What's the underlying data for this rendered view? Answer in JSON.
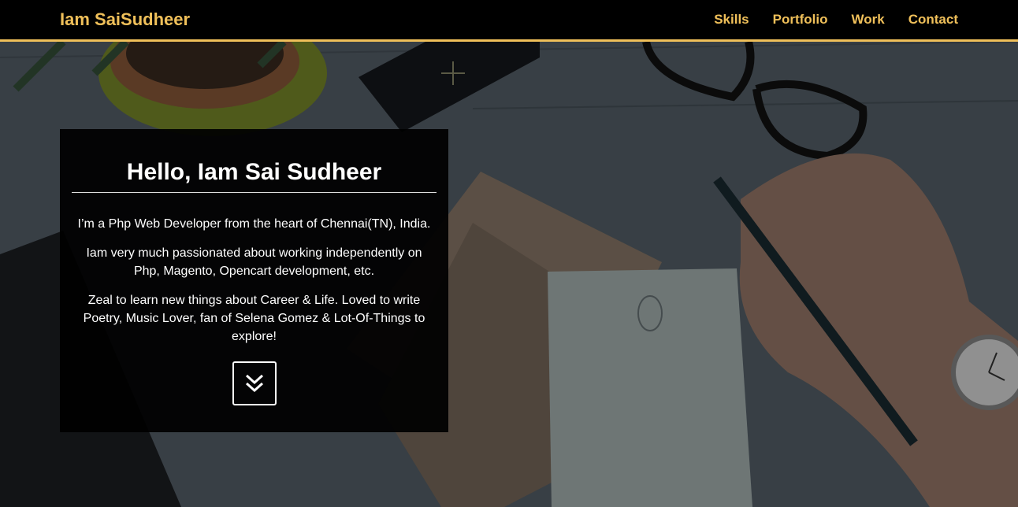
{
  "navbar": {
    "brand": "Iam SaiSudheer",
    "links": [
      {
        "label": "Skills"
      },
      {
        "label": "Portfolio"
      },
      {
        "label": "Work"
      },
      {
        "label": "Contact"
      }
    ]
  },
  "intro": {
    "title": "Hello, Iam Sai Sudheer",
    "paragraphs": [
      "I’m a Php Web Developer from the heart of Chennai(TN), India.",
      "Iam very much passionated about working independently on Php, Magento, Opencart development, etc.",
      "Zeal to learn new things about Career & Life. Loved to write Poetry, Music Lover, fan of Selena Gomez & Lot-Of-Things to explore!"
    ],
    "scroll_button_icon": "double-chevron-down-icon"
  },
  "colors": {
    "accent": "#f0c05a",
    "navbar_bg": "#000000",
    "panel_bg": "#000000"
  }
}
